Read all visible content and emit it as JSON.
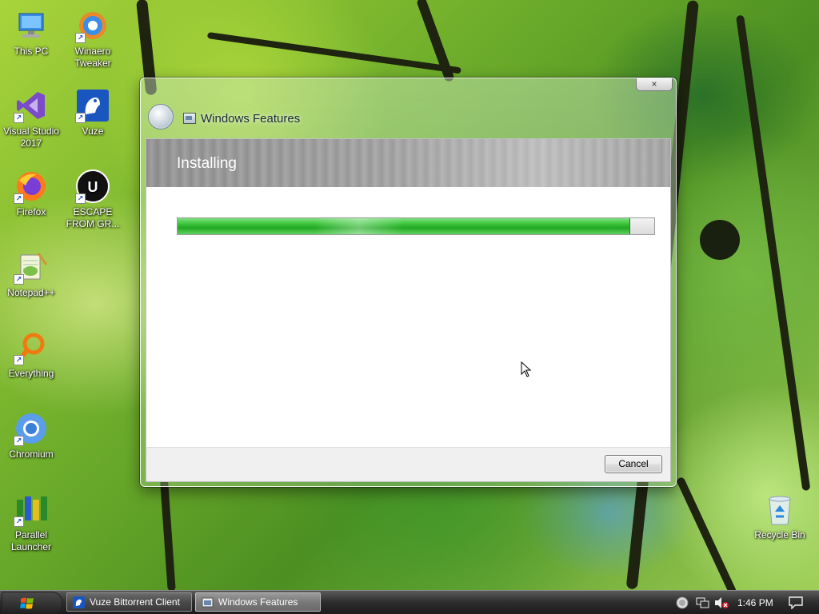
{
  "desktop": {
    "icons": [
      {
        "label": "This PC",
        "icon": "computer-icon"
      },
      {
        "label": "Winaero Tweaker",
        "icon": "winaero-tweaker-icon"
      },
      {
        "label": "Visual Studio 2017",
        "icon": "visual-studio-icon"
      },
      {
        "label": "Vuze",
        "icon": "vuze-frog-icon"
      },
      {
        "label": "Firefox",
        "icon": "firefox-icon"
      },
      {
        "label": "ESCAPE FROM GR...",
        "icon": "unreal-engine-icon"
      },
      {
        "label": "Notepad++",
        "icon": "notepad-plus-plus-icon"
      },
      {
        "label": "Everything",
        "icon": "magnifier-icon"
      },
      {
        "label": "Chromium",
        "icon": "chromium-icon"
      },
      {
        "label": "Parallel Launcher",
        "icon": "parallel-launcher-icon"
      },
      {
        "label": "Recycle Bin",
        "icon": "recycle-bin-icon"
      }
    ]
  },
  "window": {
    "title": "Windows Features",
    "close_label": "×",
    "header": "Installing",
    "progress": 0.95,
    "cancel_label": "Cancel"
  },
  "taskbar": {
    "tasks": [
      {
        "label": "Vuze Bittorrent Client",
        "icon": "vuze-frog-icon",
        "active": false
      },
      {
        "label": "Windows Features",
        "icon": "window-icon",
        "active": true
      }
    ],
    "tray": {
      "time": "1:46 PM",
      "icons": [
        "clock-globe-icon",
        "network-icon",
        "volume-muted-icon",
        "action-center-icon"
      ]
    }
  },
  "colors": {
    "progress_fill": "#3cc43c",
    "taskbar": "#2e2e2e",
    "header_band": "#9a9a9a"
  }
}
